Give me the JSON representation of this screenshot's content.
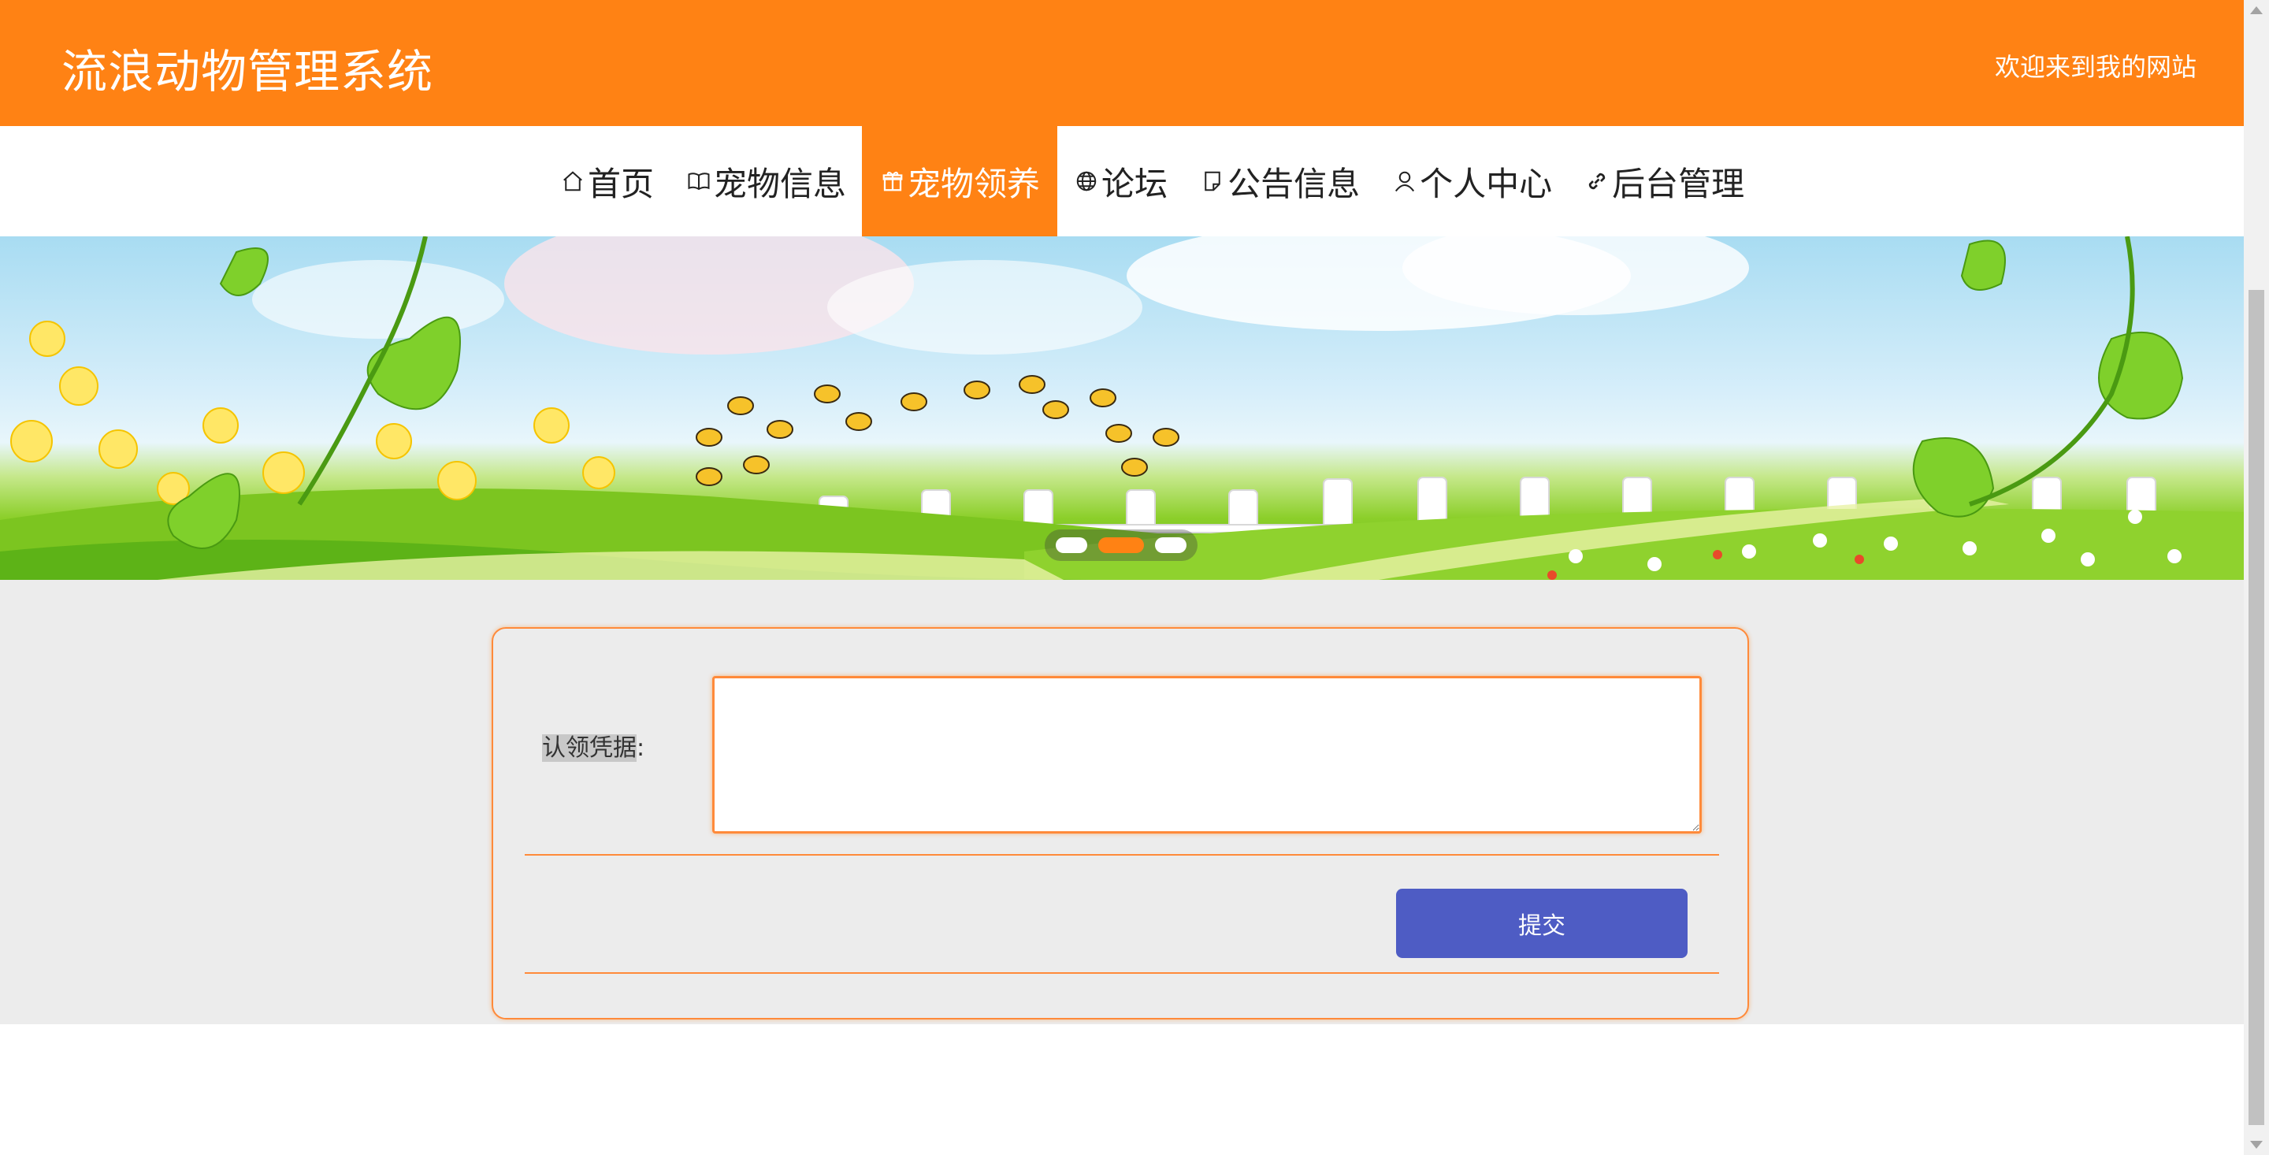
{
  "header": {
    "site_title": "流浪动物管理系统",
    "welcome_text": "欢迎来到我的网站"
  },
  "nav": {
    "items": [
      {
        "label": "首页",
        "icon": "home-icon"
      },
      {
        "label": "宠物信息",
        "icon": "book-icon"
      },
      {
        "label": "宠物领养",
        "icon": "gift-icon",
        "active": true
      },
      {
        "label": "论坛",
        "icon": "globe-icon"
      },
      {
        "label": "公告信息",
        "icon": "file-icon"
      },
      {
        "label": "个人中心",
        "icon": "user-icon"
      },
      {
        "label": "后台管理",
        "icon": "link-icon"
      }
    ]
  },
  "banner": {
    "slide_count": 3,
    "active_slide": 2
  },
  "form": {
    "proof_label": "认领凭据",
    "label_suffix": ":",
    "proof_value": "",
    "submit_label": "提交"
  },
  "colors": {
    "brand": "#ff8214",
    "button": "#4e5cc4",
    "content_bg": "#ececec"
  }
}
